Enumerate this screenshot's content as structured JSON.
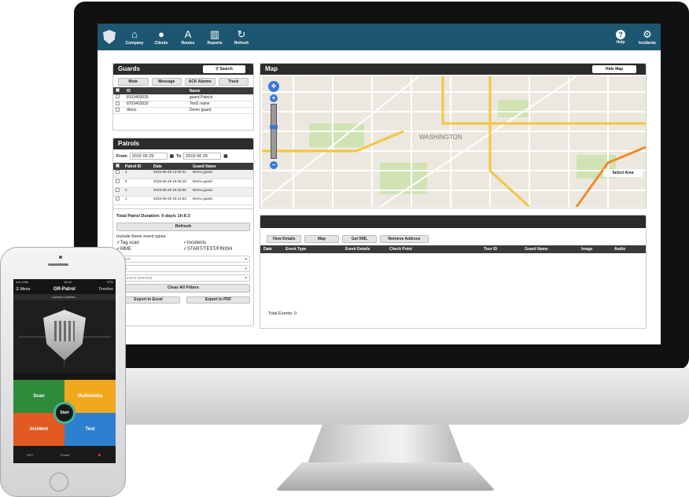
{
  "toolbar": {
    "items": [
      {
        "label": "Company",
        "icon": "home-icon",
        "glyph": "⌂"
      },
      {
        "label": "Clients",
        "icon": "person-icon",
        "glyph": "●"
      },
      {
        "label": "Routes",
        "icon": "route-icon",
        "glyph": "A"
      },
      {
        "label": "Reports",
        "icon": "chart-icon",
        "glyph": "▥"
      },
      {
        "label": "Refresh",
        "icon": "refresh-icon",
        "glyph": "↻"
      }
    ],
    "help_label": "Help",
    "help_glyph": "?",
    "incidents_label": "Incidents",
    "incidents_glyph": "⚙"
  },
  "guards": {
    "title": "Guards",
    "search_label": "Search",
    "buttons": [
      "Mute",
      "Message",
      "ACK Alarms",
      "Track"
    ],
    "columns": [
      "ID",
      "Name"
    ],
    "rows": [
      {
        "id": "8103403035",
        "name": "guard Patrick"
      },
      {
        "id": "8703403032",
        "name": "Test1 name"
      },
      {
        "id": "demo",
        "name": "Demo guard"
      }
    ]
  },
  "patrols": {
    "title": "Patrols",
    "from_label": "From",
    "from_value": "2015 06 29",
    "to_label": "To",
    "to_value": "2015 06 29",
    "columns": [
      "Patrol ID",
      "Date",
      "Guard Name"
    ],
    "rows": [
      {
        "id": "4",
        "date": "2015-06-29 12:09:21",
        "guard": "Demo guard"
      },
      {
        "id": "3",
        "date": "2015-06-29 10:45:18",
        "guard": "Demo guard"
      },
      {
        "id": "2",
        "date": "2015-06-29 10:33:00",
        "guard": "Demo guard"
      },
      {
        "id": "1",
        "date": "2015-06-29 10:12:53",
        "guard": "Demo guard"
      }
    ],
    "total_label": "Total Patrol Duration: 0 day/s 1h:6:3",
    "refresh_label": "Refresh",
    "include_label": "Include these event types:",
    "checks": [
      "Tag scan",
      "Incidents",
      "MME",
      "START/TEST/FINISH"
    ],
    "client_placeholder": "Client",
    "site_placeholder": "Site",
    "event_placeholder": "No event selected",
    "clear_label": "Clear All Filters",
    "export_excel": "Export to Excel",
    "export_pdf": "Export to PDF"
  },
  "map": {
    "title": "Map",
    "hide_label": "Hide Map",
    "select_area_label": "Select Area",
    "city_label": "WASHINGTON"
  },
  "events": {
    "buttons": [
      "View Details",
      "Map",
      "Get KML",
      "Retrieve Address"
    ],
    "columns": [
      "Date",
      "Event Type",
      "Event Details",
      "Check Point",
      "Tour ID",
      "Guard Name",
      "Image",
      "Audio"
    ],
    "total_label": "Total Events: 0"
  },
  "phone": {
    "status_left": "ooo Vdfn",
    "status_time": "16:34",
    "status_right": "97%",
    "menu_label": "Menu",
    "app_title": "GR-Patrol",
    "timeline_label": "Timeline",
    "subtitle": "Lorenzo Lachimi...",
    "tiles": [
      "Scan",
      "Multimedia",
      "Incident",
      "Test"
    ],
    "start_label": "Start",
    "bottom_left": "NFC",
    "bottom_mid": "Sound"
  }
}
